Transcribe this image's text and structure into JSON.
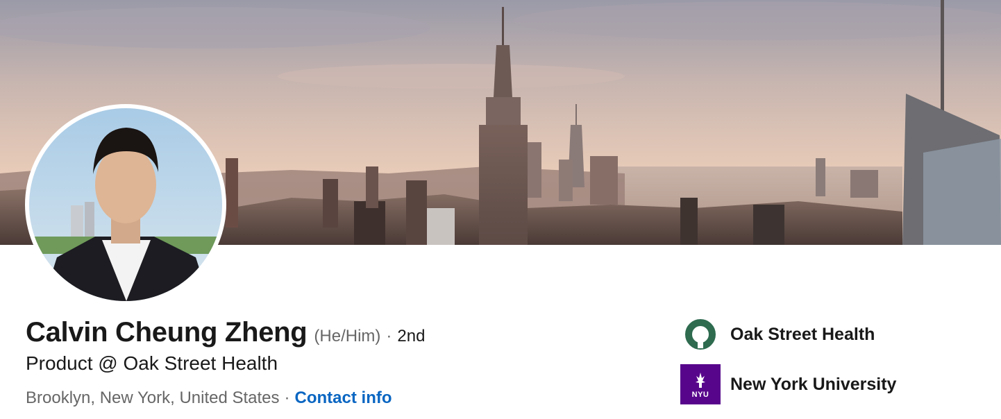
{
  "profile": {
    "name": "Calvin Cheung Zheng",
    "pronouns": "(He/Him)",
    "separator": "·",
    "degree": "2nd",
    "headline": "Product @ Oak Street Health",
    "location": "Brooklyn, New York, United States",
    "contact_label": "Contact info"
  },
  "organizations": [
    {
      "name": "Oak Street Health",
      "icon": "oak-street-health-logo"
    },
    {
      "name": "New York University",
      "icon": "nyu-logo",
      "logo_text": "NYU",
      "color": "#57068c"
    }
  ],
  "colors": {
    "link": "#0a66c2",
    "muted": "#666666",
    "text": "#191919",
    "oak_green": "#2e6b4f"
  }
}
